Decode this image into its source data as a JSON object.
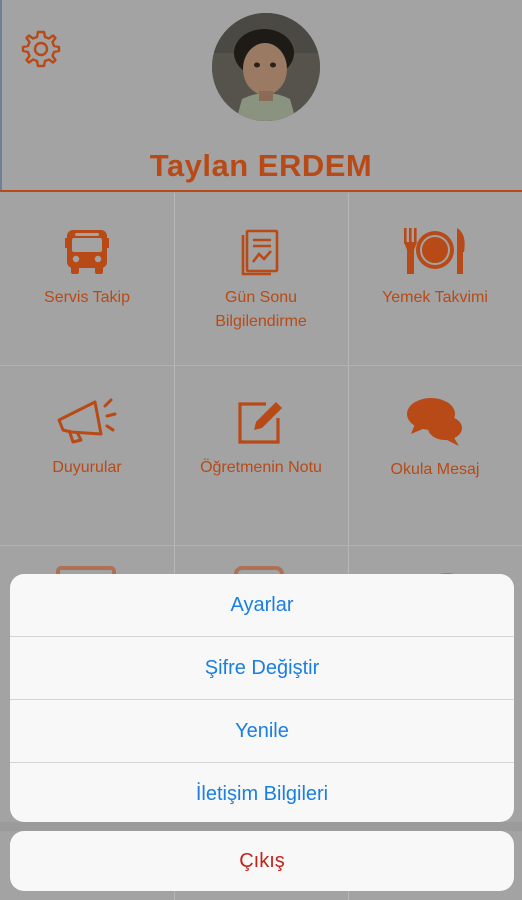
{
  "profile": {
    "name": "Taylan ERDEM",
    "avatar_icon": "child-photo"
  },
  "header": {
    "settings_icon": "gear-icon"
  },
  "menu": {
    "items": [
      {
        "label": "Servis Takip",
        "icon": "bus-icon"
      },
      {
        "label": "Gün Sonu Bilgilendirme",
        "icon": "report-icon"
      },
      {
        "label": "Yemek Takvimi",
        "icon": "cutlery-icon"
      },
      {
        "label": "Duyurular",
        "icon": "megaphone-icon"
      },
      {
        "label": "Öğretmenin Notu",
        "icon": "edit-icon"
      },
      {
        "label": "Okula Mesaj",
        "icon": "chat-icon"
      }
    ]
  },
  "action_sheet": {
    "options": [
      "Ayarlar",
      "Şifre Değiştir",
      "Yenile",
      "İletişim Bilgileri"
    ],
    "cancel": "Çıkış"
  },
  "colors": {
    "accent": "#b84a17",
    "overlay_background": "#a3a3a3",
    "option_text": "#1a7fe0",
    "cancel_text": "#c2221a"
  }
}
